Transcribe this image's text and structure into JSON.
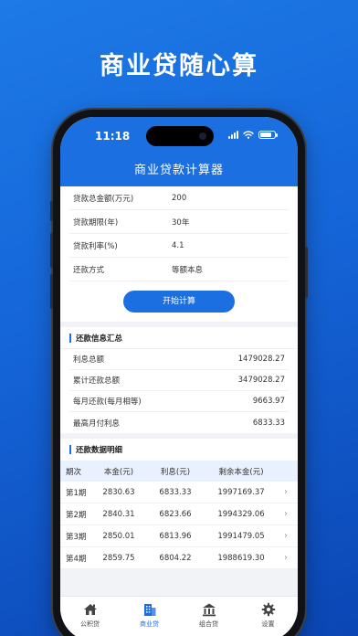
{
  "hero_title": "商业贷随心算",
  "status_bar": {
    "time": "11:18"
  },
  "app_title": "商业贷款计算器",
  "form": {
    "rows": [
      {
        "label": "贷款总金额(万元)",
        "value": "200"
      },
      {
        "label": "贷款期限(年)",
        "value": "30年"
      },
      {
        "label": "贷款利率(%)",
        "value": "4.1"
      },
      {
        "label": "还款方式",
        "value": "等额本息"
      }
    ],
    "button": "开始计算"
  },
  "summary": {
    "title": "还款信息汇总",
    "rows": [
      {
        "label": "利息总额",
        "value": "1479028.27"
      },
      {
        "label": "累计还款总额",
        "value": "3479028.27"
      },
      {
        "label": "每月还款(每月相等)",
        "value": "9663.97"
      },
      {
        "label": "最高月付利息",
        "value": "6833.33"
      }
    ]
  },
  "details": {
    "title": "还款数据明细",
    "columns": [
      "期次",
      "本金(元)",
      "利息(元)",
      "剩余本金(元)"
    ],
    "rows": [
      {
        "period": "第1期",
        "principal": "2830.63",
        "interest": "6833.33",
        "remaining": "1997169.37"
      },
      {
        "period": "第2期",
        "principal": "2840.31",
        "interest": "6823.66",
        "remaining": "1994329.06"
      },
      {
        "period": "第3期",
        "principal": "2850.01",
        "interest": "6813.96",
        "remaining": "1991479.05"
      },
      {
        "period": "第4期",
        "principal": "2859.75",
        "interest": "6804.22",
        "remaining": "1988619.30"
      }
    ]
  },
  "tabbar": {
    "items": [
      {
        "label": "公积贷",
        "icon": "house-icon"
      },
      {
        "label": "商业贷",
        "icon": "building-icon"
      },
      {
        "label": "组合贷",
        "icon": "bank-icon"
      },
      {
        "label": "设置",
        "icon": "gear-icon"
      }
    ],
    "active_index": 1
  },
  "colors": {
    "accent": "#1b6fe0",
    "background_gradient_start": "#1d7ae6",
    "background_gradient_end": "#0b46b4"
  }
}
